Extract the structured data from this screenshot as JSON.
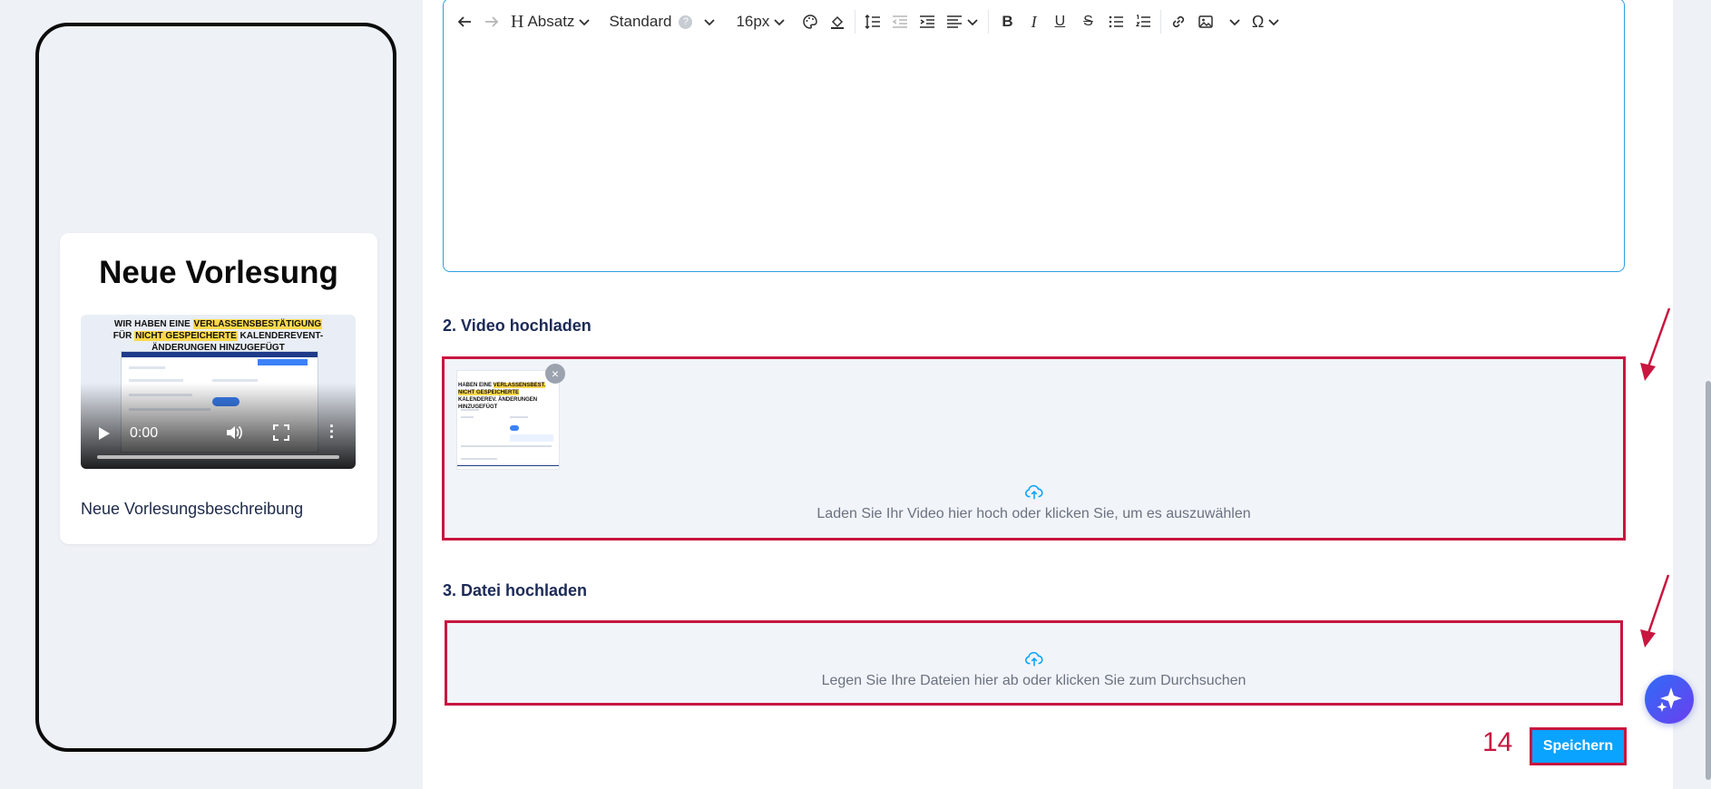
{
  "preview": {
    "title": "Neue Vorlesung",
    "video": {
      "caption_parts": [
        "WIR HABEN EINE ",
        "VERLASSENSBESTÄTIGUNG",
        " FÜR ",
        "NICHT GESPEICHERTE",
        " KALENDEREVENT-ÄNDERUNGEN HINZUGEFÜGT"
      ],
      "time": "0:00"
    },
    "description": "Neue Vorlesungsbeschreibung"
  },
  "toolbar": {
    "block_format": "Absatz",
    "font_family": "Standard",
    "font_size": "16px",
    "help_label": "?",
    "bold_label": "B",
    "italic_label": "I",
    "underline_label": "U",
    "strike_label": "S",
    "special_char_label": "Ω"
  },
  "video_section": {
    "label": "2. Video hochladen",
    "dropzone_text": "Laden Sie Ihr Video hier hoch oder klicken Sie, um es auszuwählen",
    "thumbnail_caption_parts": [
      "HABEN EINE ",
      "VERLASSENSBEST.",
      " ",
      "NICHT GESPEICHERTE",
      " KALENDEREV. ÄNDERUNGEN HINZUGEFÜGT"
    ],
    "remove_label": "×"
  },
  "file_section": {
    "label": "3. Datei hochladen",
    "dropzone_text": "Legen Sie Ihre Dateien hier ab oder klicken Sie zum Durchsuchen"
  },
  "save": {
    "label": "Speichern",
    "step_number": "14"
  },
  "colors": {
    "annotation_red": "#c8163f",
    "primary_blue": "#0aa3ff",
    "editor_border": "#2f9ee3",
    "heading_navy": "#1c2a57"
  },
  "icons": [
    "undo-icon",
    "redo-icon",
    "heading-icon",
    "chevron-down-icon",
    "palette-icon",
    "fill-icon",
    "line-height-icon",
    "outdent-icon",
    "indent-icon",
    "align-icon",
    "list-icon",
    "ordered-list-icon",
    "link-icon",
    "image-icon",
    "upload-cloud-icon",
    "sparkle-icon"
  ]
}
